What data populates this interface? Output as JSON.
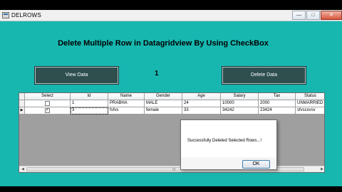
{
  "window": {
    "title": "DELROWS",
    "minimize": "—",
    "maximize": "□",
    "close": "✕"
  },
  "heading": "Delete Multiple Row in Datagridview By Using CheckBox",
  "view_button": "View Data",
  "delete_button": "Delete Data",
  "count_label": "1",
  "grid": {
    "columns": [
      "Select",
      "Id",
      "Name",
      "Gender",
      "Age",
      "Salary",
      "Tax",
      "Status"
    ],
    "rows": [
      {
        "checked": false,
        "id": "1",
        "name": "PRABHA",
        "gender": "MALE",
        "age": "24",
        "salary": "10000",
        "tax": "2000",
        "status": "UNMARRIED"
      },
      {
        "checked": true,
        "id": "3",
        "name": "fsfvs",
        "gender": "female",
        "age": "33",
        "salary": "34242",
        "tax": "23424",
        "status": "sfvscxvsv"
      }
    ],
    "current_row_indicator": "▶",
    "check_mark": "✓",
    "scroll_left": "◀",
    "scroll_right": "▶",
    "scroll_grip": "III"
  },
  "message_box": {
    "text": "Successfully Deleted Selected Rows...!",
    "ok_label": "OK"
  },
  "colors": {
    "form_background": "#17b7b0",
    "button_background": "#2f4f4f"
  }
}
